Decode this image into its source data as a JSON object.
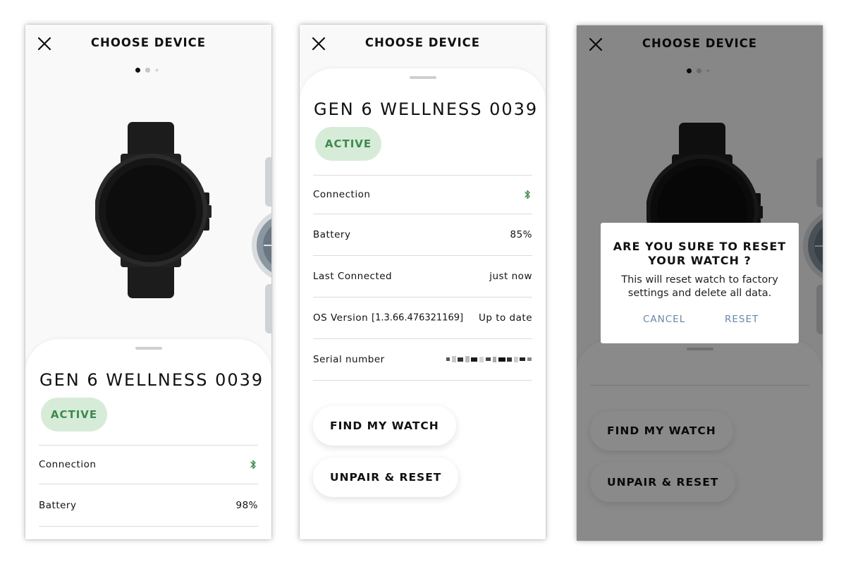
{
  "header": {
    "title": "CHOOSE DEVICE"
  },
  "device": {
    "name": "GEN 6 WELLNESS 0039",
    "status": "ACTIVE"
  },
  "screen1": {
    "rows": [
      {
        "label": "Connection",
        "icon": "bluetooth-icon"
      },
      {
        "label": "Battery",
        "value": "98%"
      }
    ]
  },
  "screen2": {
    "rows": [
      {
        "label": "Connection",
        "icon": "bluetooth-icon"
      },
      {
        "label": "Battery",
        "value": "85%"
      },
      {
        "label": "Last Connected",
        "value": "just now"
      },
      {
        "label": "OS Version",
        "version": "[1.3.66.476321169]",
        "value": "Up to date"
      },
      {
        "label": "Serial number",
        "value_hidden": true
      }
    ],
    "buttons": {
      "find": "FIND MY WATCH",
      "unpair": "UNPAIR & RESET"
    }
  },
  "dialog": {
    "title": "ARE YOU SURE TO RESET YOUR WATCH ?",
    "message": "This will reset watch to factory settings and delete all data.",
    "cancel": "CANCEL",
    "reset": "RESET"
  },
  "colors": {
    "active_bg": "#d7ebd9",
    "active_text": "#3e8a4c",
    "bluetooth": "#3e8a4c",
    "dialog_button": "#6b86a8",
    "overlay": "rgba(0,0,0,0.46)"
  }
}
